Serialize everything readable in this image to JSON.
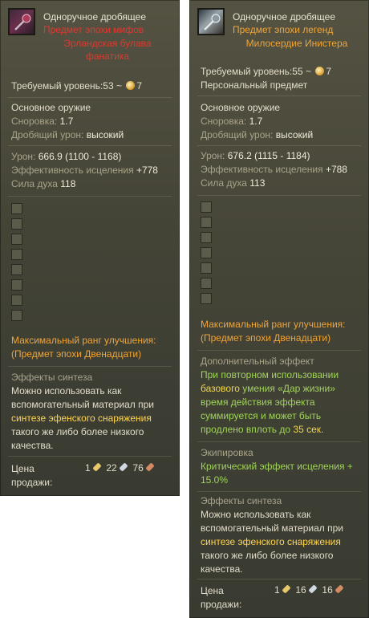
{
  "left": {
    "item_type": "Одноручное дробящее",
    "item_grade": "Предмет эпохи мифов",
    "item_name": "Эрландская булава фанатика",
    "req_level_label": "Требуемый уровень:",
    "req_level_value": "53 ~",
    "req_enchant": "7",
    "weapon_class": "Основное оружие",
    "agility_label": "Сноровка:",
    "agility_value": "1.7",
    "blunt_label": "Дробящий урон:",
    "blunt_value": "высокий",
    "damage_label": "Урон:",
    "damage_value": "666.9 (1100 - 1168)",
    "heal_label": "Эффективность исцеления",
    "heal_value": "+778",
    "spirit_label": "Сила духа",
    "spirit_value": "118",
    "max_rank_line1": "Максимальный ранг улучшения:",
    "max_rank_line2": "(Предмет эпохи Двенадцати)",
    "synth_title": "Эффекты синтеза",
    "synth_t1": "Можно использовать как",
    "synth_t2": "вспомогательный материал при",
    "synth_t3": "синтезе эфенского снаряжения",
    "synth_t4": "такого же либо более низкого",
    "synth_t5": "качества.",
    "price_label_1": "Цена",
    "price_label_2": "продажи:",
    "price_gold": "1",
    "price_silver": "22",
    "price_copper": "76"
  },
  "right": {
    "item_type": "Одноручное дробящее",
    "item_grade": "Предмет эпохи легенд",
    "item_name": "Милосердие Инистера",
    "req_level_label": "Требуемый уровень:",
    "req_level_value": "55 ~",
    "req_enchant": "7",
    "personal": "Персональный предмет",
    "weapon_class": "Основное оружие",
    "agility_label": "Сноровка:",
    "agility_value": "1.7",
    "blunt_label": "Дробящий урон:",
    "blunt_value": "высокий",
    "damage_label": "Урон:",
    "damage_value": "676.2 (1115 - 1184)",
    "heal_label": "Эффективность исцеления",
    "heal_value": "+788",
    "spirit_label": "Сила духа",
    "spirit_value": "113",
    "max_rank_line1": "Максимальный ранг улучшения:",
    "max_rank_line2": "(Предмет эпохи Двенадцати)",
    "extra_title": "Дополнительный эффект",
    "extra_t1": "При повторном использовании",
    "extra_t2a": "базового",
    "extra_t2b": "умения «Дар жизни»",
    "extra_t3": "время действия эффекта",
    "extra_t4": "суммируется и может быть",
    "extra_t5a": "продлено вплоть до",
    "extra_t5b": "35 сек.",
    "equip_title": "Экипировка",
    "equip_t1": "Критический эффект исцеления +",
    "equip_t2": "15.0%",
    "synth_title": "Эффекты синтеза",
    "synth_t1": "Можно использовать как",
    "synth_t2": "вспомогательный материал при",
    "synth_t3": "синтезе эфенского снаряжения",
    "synth_t4": "такого же либо более низкого",
    "synth_t5": "качества.",
    "price_label_1": "Цена",
    "price_label_2": "продажи:",
    "price_gold": "1",
    "price_silver": "16",
    "price_copper": "16"
  },
  "colors": {
    "mythic": "#e0382e",
    "legendary": "#f0a436",
    "effect_green": "#9fd35a",
    "highlight_yellow": "#ffd452"
  },
  "icons": {
    "left_item": "mace-icon",
    "right_item": "mace-icon",
    "enchant": "enchant-stone-icon",
    "gold": "gold-coin-icon",
    "silver": "silver-coin-icon",
    "copper": "copper-coin-icon"
  }
}
